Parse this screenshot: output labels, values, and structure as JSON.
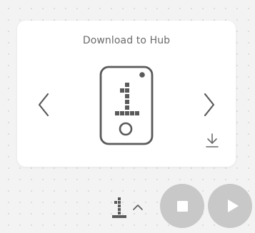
{
  "download_panel": {
    "title": "Download to Hub",
    "selected_program_slot": 1,
    "icons": {
      "previous": "chevron-left-icon",
      "next": "chevron-right-icon",
      "device": "hub-device-icon",
      "download": "download-icon"
    }
  },
  "bottom_bar": {
    "program_slot": 1,
    "icons": {
      "slot": "program-slot-icon",
      "expand": "caret-up-icon",
      "stop": "stop-icon",
      "play": "play-icon"
    }
  },
  "colors": {
    "icon_gray": "#5a5a5a",
    "button_gray": "#c8c8c8",
    "card_bg": "#ffffff",
    "page_bg": "#f3f3f3"
  }
}
